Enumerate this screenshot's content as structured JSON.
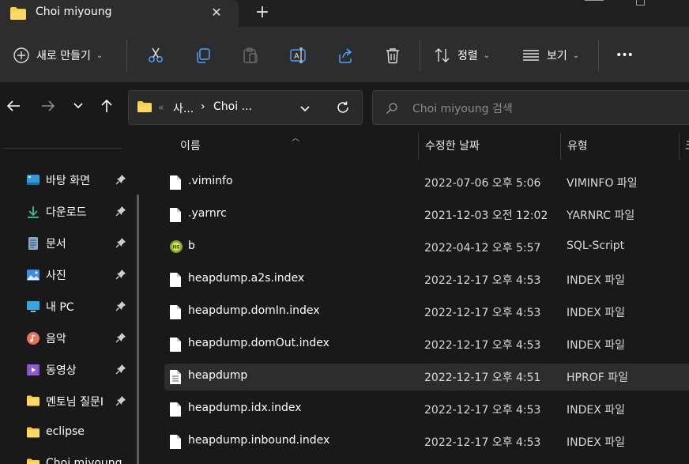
{
  "window": {
    "tab_title": "Choi miyoung",
    "close_glyph": "✕",
    "new_tab_glyph": "+"
  },
  "toolbar": {
    "new_label": "새로 만들기",
    "sort_label": "정렬",
    "view_label": "보기",
    "more_glyph": "•••",
    "icons": [
      "cut-icon",
      "copy-icon",
      "paste-icon",
      "rename-icon",
      "share-icon",
      "delete-icon"
    ]
  },
  "navigation": {
    "back_glyph": "←",
    "forward_glyph": "→",
    "recent_glyph": "⌄",
    "up_glyph": "↑"
  },
  "address": {
    "overflow": "«",
    "crumb_1": "사...",
    "separator": "›",
    "crumb_2": "Choi ...",
    "dropdown_glyph": "⌄",
    "refresh_glyph": "↻"
  },
  "search": {
    "placeholder": "Choi miyoung 검색"
  },
  "sidebar": {
    "items": [
      {
        "label": "바탕 화면",
        "icon": "desktop-icon",
        "pinned": true
      },
      {
        "label": "다운로드",
        "icon": "download-icon",
        "pinned": true
      },
      {
        "label": "문서",
        "icon": "document-icon",
        "pinned": true
      },
      {
        "label": "사진",
        "icon": "pictures-icon",
        "pinned": true
      },
      {
        "label": "내 PC",
        "icon": "pc-icon",
        "pinned": true
      },
      {
        "label": "음악",
        "icon": "music-icon",
        "pinned": true
      },
      {
        "label": "동영상",
        "icon": "video-icon",
        "pinned": true
      },
      {
        "label": "멘토님 질문I",
        "icon": "folder-icon",
        "pinned": true
      },
      {
        "label": "eclipse",
        "icon": "folder-icon",
        "pinned": false
      },
      {
        "label": "Choi miyoung",
        "icon": "folder-icon",
        "pinned": false
      }
    ]
  },
  "columns": {
    "name": "이름",
    "date": "수정한 날짜",
    "type": "유형",
    "size": "크"
  },
  "files": [
    {
      "name": ".viminfo",
      "date": "2022-07-06 오후 5:06",
      "type": "VIMINFO 파일",
      "icon": "file-icon"
    },
    {
      "name": ".yarnrc",
      "date": "2021-12-03 오전 12:02",
      "type": "YARNRC 파일",
      "icon": "file-icon"
    },
    {
      "name": "b",
      "date": "2022-04-12 오후 5:57",
      "type": "SQL-Script",
      "icon": "sql-script-icon"
    },
    {
      "name": "heapdump.a2s.index",
      "date": "2022-12-17 오후 4:53",
      "type": "INDEX 파일",
      "icon": "file-icon"
    },
    {
      "name": "heapdump.domIn.index",
      "date": "2022-12-17 오후 4:53",
      "type": "INDEX 파일",
      "icon": "file-icon"
    },
    {
      "name": "heapdump.domOut.index",
      "date": "2022-12-17 오후 4:53",
      "type": "INDEX 파일",
      "icon": "file-icon"
    },
    {
      "name": "heapdump",
      "date": "2022-12-17 오후 4:51",
      "type": "HPROF 파일",
      "icon": "text-file-icon",
      "selected": true
    },
    {
      "name": "heapdump.idx.index",
      "date": "2022-12-17 오후 4:53",
      "type": "INDEX 파일",
      "icon": "file-icon"
    },
    {
      "name": "heapdump.inbound.index",
      "date": "2022-12-17 오후 4:53",
      "type": "INDEX 파일",
      "icon": "file-icon"
    }
  ],
  "colors": {
    "accent": "#ffc83d",
    "background": "#191919",
    "toolbar": "#2d2d2d",
    "selected_row": "#2d2d2d"
  }
}
